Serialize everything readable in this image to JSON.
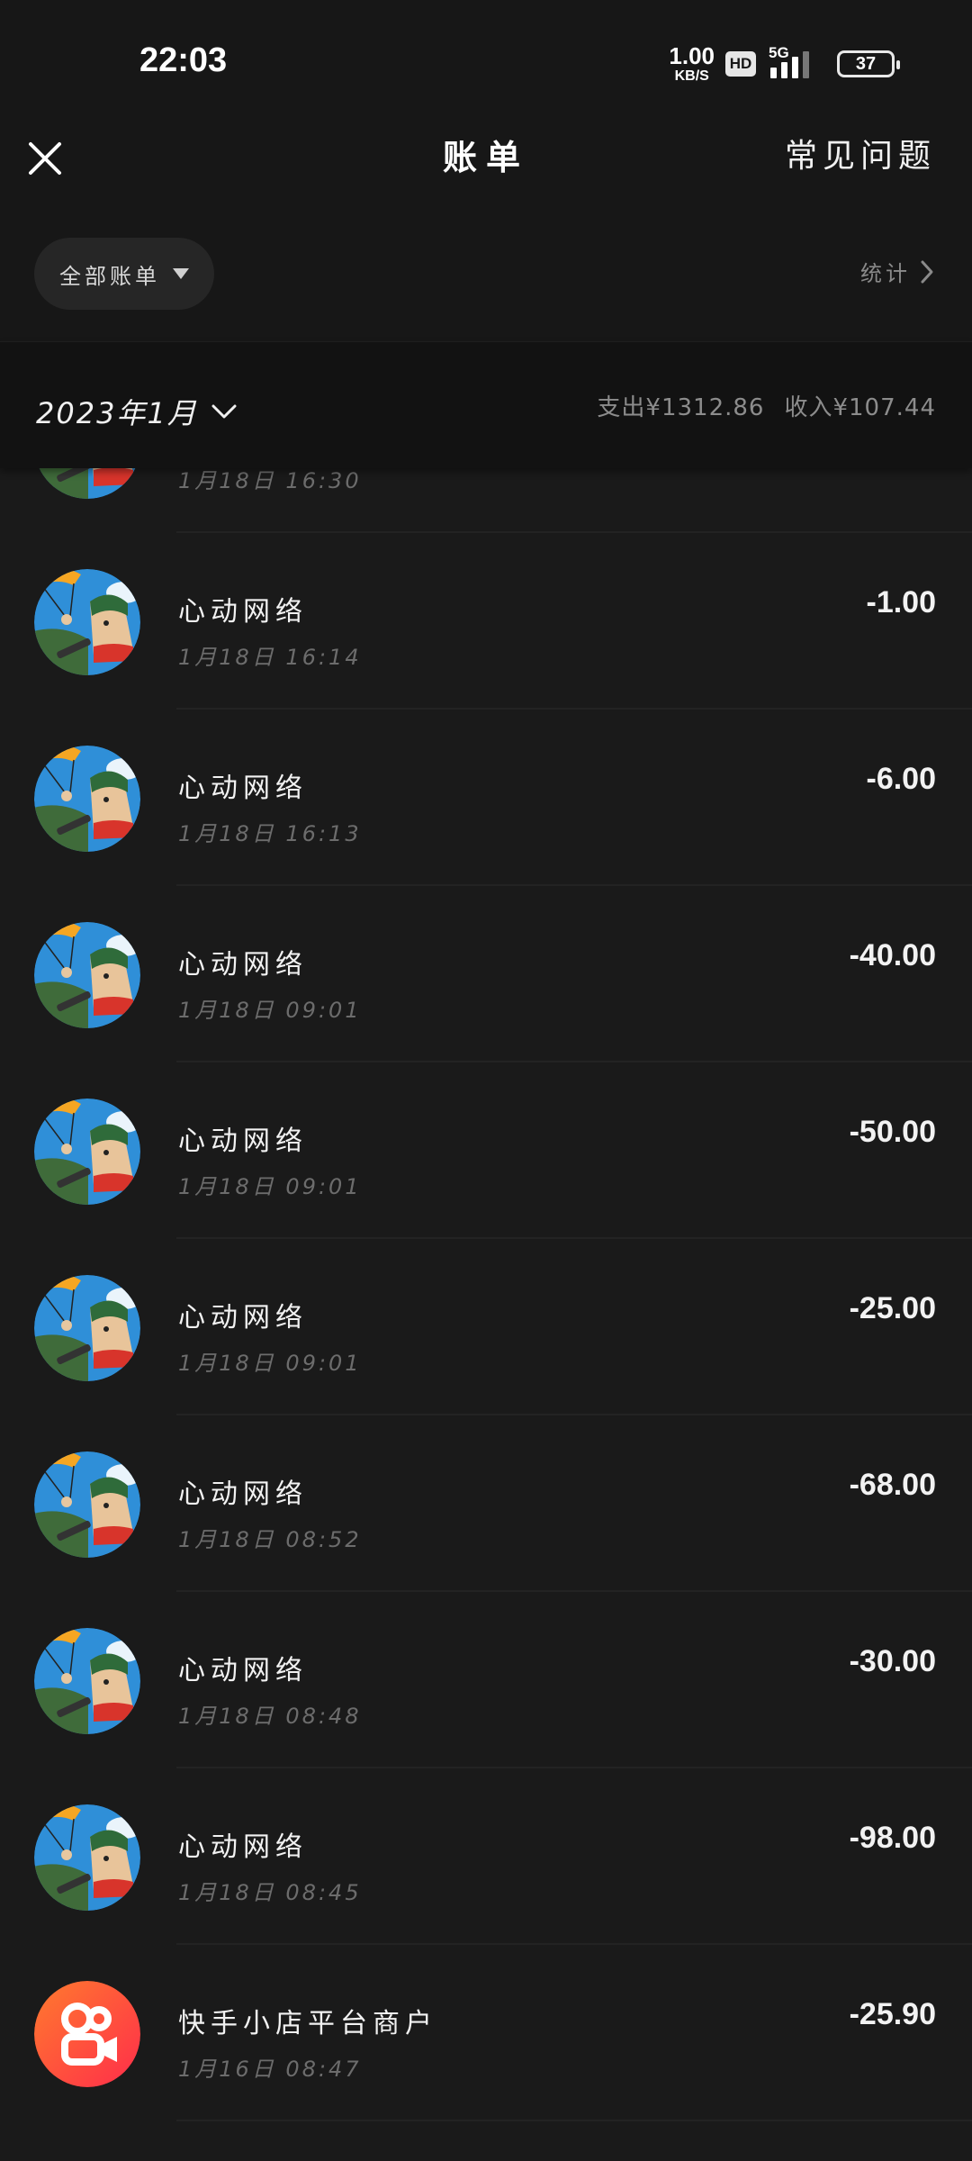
{
  "status_bar": {
    "time": "22:03",
    "net_speed_value": "1.00",
    "net_speed_unit": "KB/S",
    "hd": "HD",
    "network": "5G",
    "battery": "37"
  },
  "header": {
    "title": "账单",
    "faq": "常见问题",
    "close_icon": "close-icon"
  },
  "filter": {
    "label": "全部账单",
    "stats": "统计"
  },
  "month": {
    "label": "2023年1月",
    "expense": "支出¥1312.86",
    "income": "收入¥107.44"
  },
  "transactions": [
    {
      "name": "",
      "time": "1月18日 16:30",
      "amount": "",
      "avatar": "parachute-avatar"
    },
    {
      "name": "心动网络",
      "time": "1月18日 16:14",
      "amount": "-1.00",
      "avatar": "parachute-avatar"
    },
    {
      "name": "心动网络",
      "time": "1月18日 16:13",
      "amount": "-6.00",
      "avatar": "parachute-avatar"
    },
    {
      "name": "心动网络",
      "time": "1月18日 09:01",
      "amount": "-40.00",
      "avatar": "parachute-avatar"
    },
    {
      "name": "心动网络",
      "time": "1月18日 09:01",
      "amount": "-50.00",
      "avatar": "parachute-avatar"
    },
    {
      "name": "心动网络",
      "time": "1月18日 09:01",
      "amount": "-25.00",
      "avatar": "parachute-avatar"
    },
    {
      "name": "心动网络",
      "time": "1月18日 08:52",
      "amount": "-68.00",
      "avatar": "parachute-avatar"
    },
    {
      "name": "心动网络",
      "time": "1月18日 08:48",
      "amount": "-30.00",
      "avatar": "parachute-avatar"
    },
    {
      "name": "心动网络",
      "time": "1月18日 08:45",
      "amount": "-98.00",
      "avatar": "parachute-avatar"
    },
    {
      "name": "快手小店平台商户",
      "time": "1月16日 08:47",
      "amount": "-25.90",
      "avatar": "kuaishou-logo"
    }
  ],
  "colors": {
    "background": "#1a1a1a",
    "header_bg": "#171717",
    "month_bar_bg": "#121212",
    "kuaishou_orange": "#ff4a2a"
  }
}
